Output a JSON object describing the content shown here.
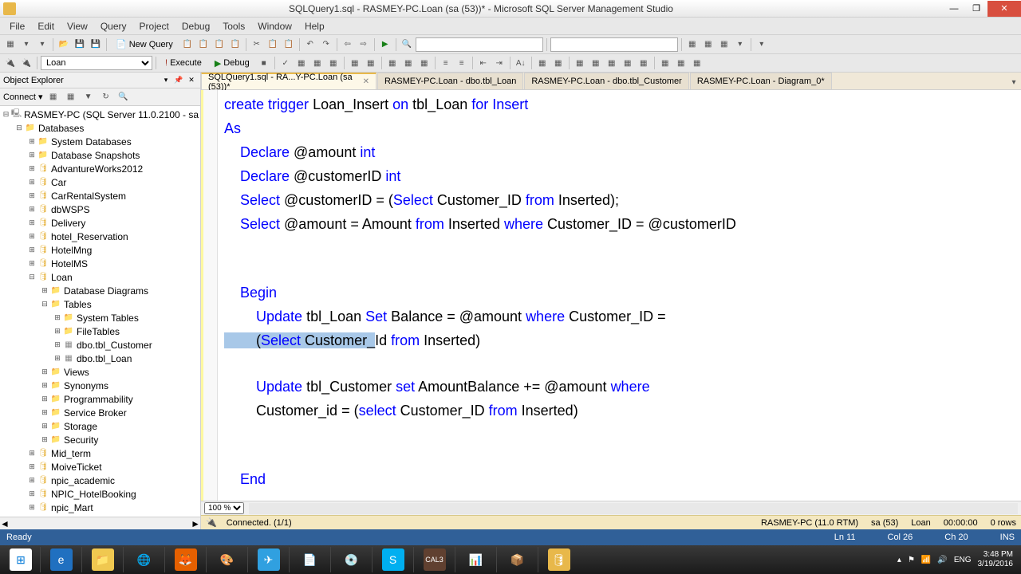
{
  "titlebar": {
    "text": "SQLQuery1.sql - RASMEY-PC.Loan (sa (53))* - Microsoft SQL Server Management Studio"
  },
  "menubar": [
    "File",
    "Edit",
    "View",
    "Query",
    "Project",
    "Debug",
    "Tools",
    "Window",
    "Help"
  ],
  "toolbar1": {
    "new_query": "New Query"
  },
  "toolbar2": {
    "db_combo": "Loan",
    "execute": "Execute",
    "debug": "Debug"
  },
  "object_explorer": {
    "title": "Object Explorer",
    "connect": "Connect ▾",
    "server": "RASMEY-PC (SQL Server 11.0.2100 - sa",
    "databases": "Databases",
    "items": [
      "System Databases",
      "Database Snapshots",
      "AdvantureWorks2012",
      "Car",
      "CarRentalSystem",
      "dbWSPS",
      "Delivery",
      "hotel_Reservation",
      "HotelMng",
      "HotelMS"
    ],
    "loan_db": "Loan",
    "loan_children": {
      "dd": "Database Diagrams",
      "tables": "Tables",
      "sys_tables": "System Tables",
      "file_tables": "FileTables",
      "tbl_customer": "dbo.tbl_Customer",
      "tbl_loan": "dbo.tbl_Loan",
      "views": "Views",
      "synonyms": "Synonyms",
      "programmability": "Programmability",
      "service_broker": "Service Broker",
      "storage": "Storage",
      "security": "Security"
    },
    "after_loan": [
      "Mid_term",
      "MoiveTicket",
      "npic_academic",
      "NPIC_HotelBooking",
      "npic_Mart"
    ]
  },
  "tabs": [
    {
      "label": "SQLQuery1.sql - RA...Y-PC.Loan (sa (53))*",
      "active": true,
      "closeable": true
    },
    {
      "label": "RASMEY-PC.Loan - dbo.tbl_Loan",
      "active": false,
      "closeable": false
    },
    {
      "label": "RASMEY-PC.Loan - dbo.tbl_Customer",
      "active": false,
      "closeable": false
    },
    {
      "label": "RASMEY-PC.Loan - Diagram_0*",
      "active": false,
      "closeable": false
    }
  ],
  "code": {
    "line1_create": "create trigger",
    "line1_name": " Loan_Insert ",
    "line1_on": "on",
    "line1_tbl": " tbl_Loan ",
    "line1_for": "for Insert",
    "line2": "As",
    "line3a": "    Declare",
    "line3b": " @amount ",
    "line3c": "int",
    "line4a": "    Declare",
    "line4b": " @customerID ",
    "line4c": "int",
    "line5a": "    Select",
    "line5b": " @customerID ",
    "line5c": "=",
    "line5d": " (",
    "line5e": "Select",
    "line5f": " Customer_ID ",
    "line5g": "from",
    "line5h": " Inserted",
    "line5i": ");",
    "line6a": "    Select",
    "line6b": " @amount ",
    "line6c": "=",
    "line6d": " Amount ",
    "line6e": "from",
    "line6f": " Inserted ",
    "line6g": "where",
    "line6h": " Customer_ID ",
    "line6i": "=",
    "line6j": " @customerID",
    "line8": "    Begin",
    "line9a": "        Update",
    "line9b": " tbl_Loan ",
    "line9c": "Set",
    "line9d": " Balance ",
    "line9e": "=",
    "line9f": " @amount ",
    "line9g": "where",
    "line9h": " Customer_ID ",
    "line9i": "=",
    "line10a": "        (",
    "line10sel": "Select",
    "line10cust": " Customer_",
    "line10b": "Id ",
    "line10c": "from",
    "line10d": " Inserted",
    "line10e": ")",
    "line12a": "        Update",
    "line12b": " tbl_Customer ",
    "line12c": "set",
    "line12d": " AmountBalance ",
    "line12e": "+=",
    "line12f": " @amount ",
    "line12g": "where",
    "line13a": "        Customer_id ",
    "line13b": "=",
    "line13c": " (",
    "line13d": "select",
    "line13e": " Customer_ID ",
    "line13f": "from",
    "line13g": " Inserted",
    "line13h": ")",
    "line15": "    End"
  },
  "zoom": "100 %",
  "status_conn": {
    "connected": "Connected. (1/1)",
    "server": "RASMEY-PC (11.0 RTM)",
    "user": "sa (53)",
    "db": "Loan",
    "time": "00:00:00",
    "rows": "0 rows"
  },
  "statusbar": {
    "ready": "Ready",
    "ln": "Ln 11",
    "col": "Col 26",
    "ch": "Ch 20",
    "ins": "INS"
  },
  "taskbar": {
    "lang": "ENG",
    "time": "3:48 PM",
    "date": "3/19/2016"
  }
}
